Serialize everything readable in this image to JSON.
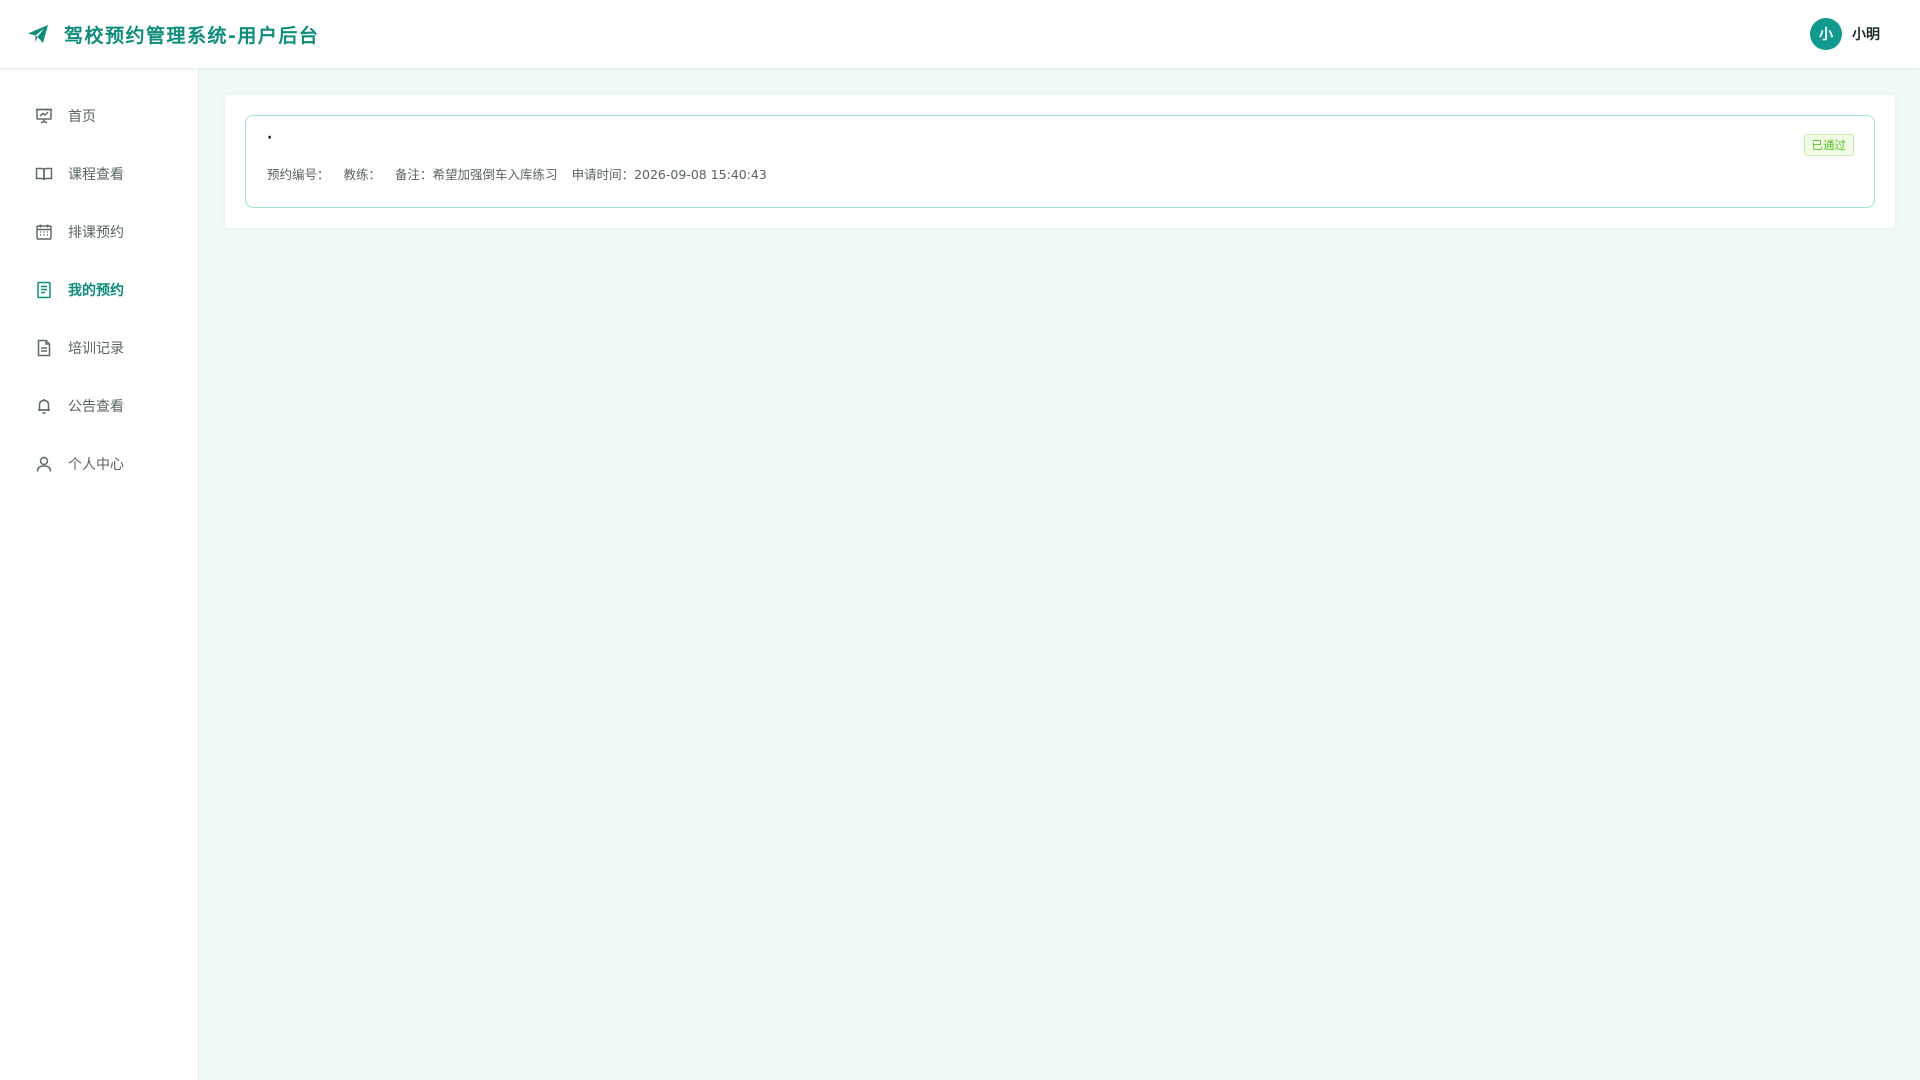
{
  "header": {
    "title": "驾校预约管理系统-用户后台",
    "brand_icon": "paper-plane-icon",
    "user": {
      "avatar_text": "小",
      "name": "小明"
    }
  },
  "colors": {
    "primary": "#0f8d7c",
    "avatar": "#11998e",
    "page_bg": "#f0fbf9",
    "card_border": "#9fe3d4",
    "status_green": "#52c41a"
  },
  "sidebar": {
    "items": [
      {
        "label": "首页",
        "icon": "presentation-board-icon",
        "active": false
      },
      {
        "label": "课程查看",
        "icon": "open-book-icon",
        "active": false
      },
      {
        "label": "排课预约",
        "icon": "calendar-icon",
        "active": false
      },
      {
        "label": "我的预约",
        "icon": "document-list-icon",
        "active": true
      },
      {
        "label": "培训记录",
        "icon": "file-text-icon",
        "active": false
      },
      {
        "label": "公告查看",
        "icon": "bell-icon",
        "active": false
      },
      {
        "label": "个人中心",
        "icon": "user-icon",
        "active": false
      }
    ]
  },
  "bookings": [
    {
      "title": "·",
      "status": "已通过",
      "booking_no_label": "预约编号：",
      "booking_no": "",
      "coach_label": "教练：",
      "coach": "",
      "remark_label": "备注：",
      "remark": "希望加强倒车入库练习",
      "apply_time_label": "申请时间：",
      "apply_time": "2026-09-08 15:40:43"
    }
  ]
}
